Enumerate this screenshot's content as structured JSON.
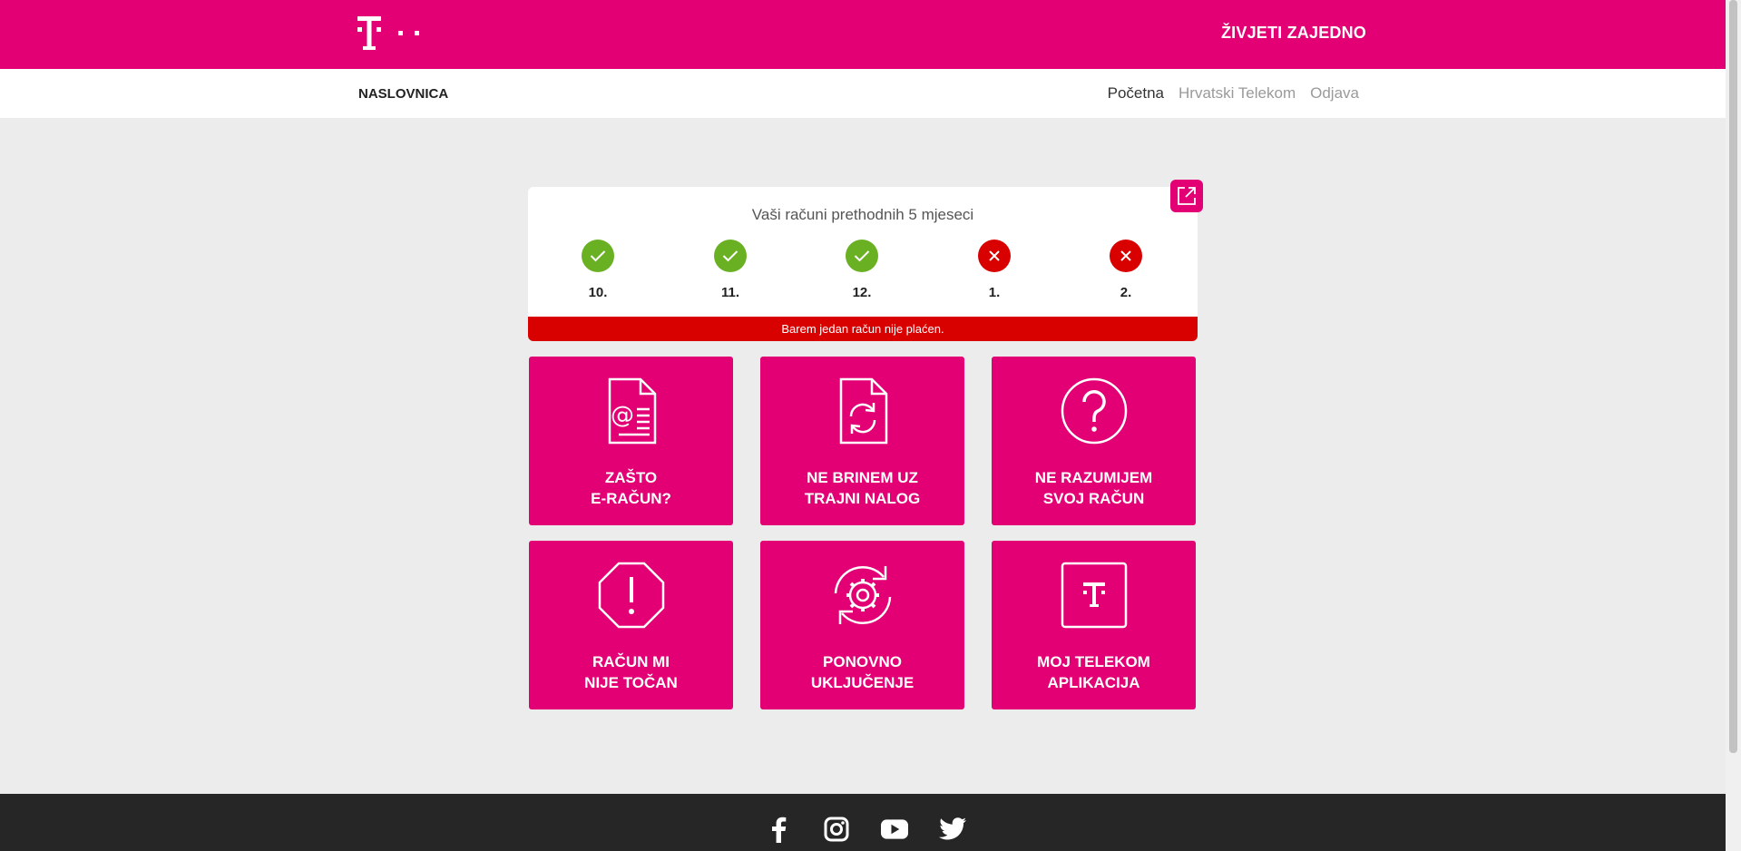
{
  "header": {
    "slogan": "ŽIVJETI ZAJEDNO"
  },
  "nav": {
    "title": "NASLOVNICA",
    "links": [
      {
        "label": "Početna",
        "active": true
      },
      {
        "label": "Hrvatski Telekom",
        "active": false
      },
      {
        "label": "Odjava",
        "active": false
      }
    ]
  },
  "bills": {
    "title": "Vaši računi prethodnih 5 mjeseci",
    "months": [
      {
        "label": "10.",
        "status": "paid"
      },
      {
        "label": "11.",
        "status": "paid"
      },
      {
        "label": "12.",
        "status": "paid"
      },
      {
        "label": "1.",
        "status": "unpaid"
      },
      {
        "label": "2.",
        "status": "unpaid"
      }
    ],
    "alert": "Barem jedan račun nije plaćen."
  },
  "tiles": [
    {
      "line1": "ZAŠTO",
      "line2": "E-RAČUN?",
      "icon": "e-bill-icon"
    },
    {
      "line1": "NE BRINEM UZ",
      "line2": "TRAJNI NALOG",
      "icon": "standing-order-icon"
    },
    {
      "line1": "NE RAZUMIJEM",
      "line2": "SVOJ RAČUN",
      "icon": "question-icon"
    },
    {
      "line1": "RAČUN MI",
      "line2": "NIJE TOČAN",
      "icon": "warning-octagon-icon"
    },
    {
      "line1": "PONOVNO",
      "line2": "UKLJUČENJE",
      "icon": "reconnect-gear-icon"
    },
    {
      "line1": "MOJ TELEKOM",
      "line2": "APLIKACIJA",
      "icon": "telekom-app-icon"
    }
  ],
  "colors": {
    "brand": "#e20074",
    "paid": "#6ab023",
    "unpaid": "#d90000",
    "footer": "#262626"
  },
  "footer": {
    "socials": [
      "facebook-icon",
      "instagram-icon",
      "youtube-icon",
      "twitter-icon"
    ]
  }
}
